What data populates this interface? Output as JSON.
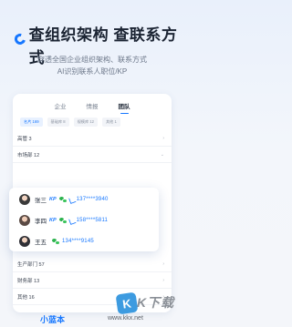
{
  "headline": "查组织架构 查联系方式",
  "subtitle_line1": "穿透全国企业组织架构、联系方式",
  "subtitle_line2": "AI识别联系人职位/KP",
  "tabs": [
    "企业",
    "情报",
    "团队"
  ],
  "active_tab_index": 2,
  "filters": [
    "名片 169",
    "基础库 8",
    "规模库 12",
    "其他 1"
  ],
  "groups_top": [
    {
      "label": "高管 3"
    },
    {
      "label": "市场部 12"
    }
  ],
  "contacts": [
    {
      "name": "张三",
      "badge": "KP",
      "phone": "137****3940"
    },
    {
      "name": "李四",
      "badge": "KP",
      "phone": "158****5811"
    },
    {
      "name": "王五",
      "badge": "",
      "phone": "134****9145"
    }
  ],
  "groups_bottom": [
    {
      "label": "生产部门 57"
    },
    {
      "label": "财务部 13"
    },
    {
      "label": "其他 16"
    }
  ],
  "bottom_brand": "小蓝本",
  "watermark": {
    "logo_letter": "K",
    "text": "K下载",
    "url": "www.kkx.net"
  },
  "colors": {
    "accent": "#1677ff",
    "wechat": "#2bb24c"
  }
}
